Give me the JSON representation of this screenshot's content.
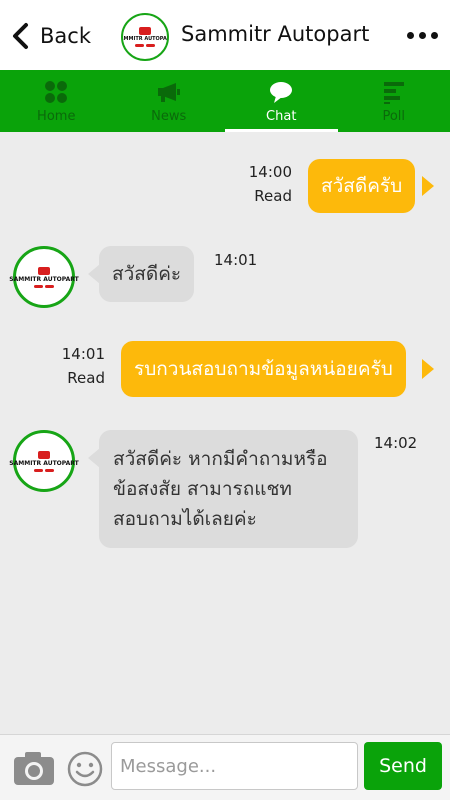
{
  "header": {
    "back_label": "Back",
    "title": "Sammitr Autopart",
    "logo_text": "SAMMITR AUTOPART"
  },
  "tabs": [
    {
      "label": "Home",
      "icon": "grid-icon",
      "active": false
    },
    {
      "label": "News",
      "icon": "megaphone-icon",
      "active": false
    },
    {
      "label": "Chat",
      "icon": "chat-bubble-icon",
      "active": true
    },
    {
      "label": "Poll",
      "icon": "poll-icon",
      "active": false
    }
  ],
  "messages": [
    {
      "direction": "out",
      "text": "สวัสดีครับ",
      "time": "14:00",
      "status": "Read"
    },
    {
      "direction": "in",
      "text": "สวัสดีค่ะ",
      "time": "14:01"
    },
    {
      "direction": "out",
      "text": "รบกวนสอบถามข้อมูลหน่อยครับ",
      "time": "14:01",
      "status": "Read"
    },
    {
      "direction": "in",
      "text": "สวัสดีค่ะ หากมีคำถามหรือข้อสงสัย สามารถแชทสอบถามได้เลยค่ะ",
      "lines": [
        "สวัสดีค่ะ หากมีคำถามหรือ",
        "ข้อสงสัย สามารถแชท",
        "สอบถามได้เลยค่ะ"
      ],
      "time": "14:02"
    }
  ],
  "input": {
    "placeholder": "Message...",
    "send_label": "Send"
  },
  "colors": {
    "brand_green": "#0aa30a",
    "outgoing_bubble": "#fdb90b",
    "incoming_bubble": "#dcdcdc"
  }
}
